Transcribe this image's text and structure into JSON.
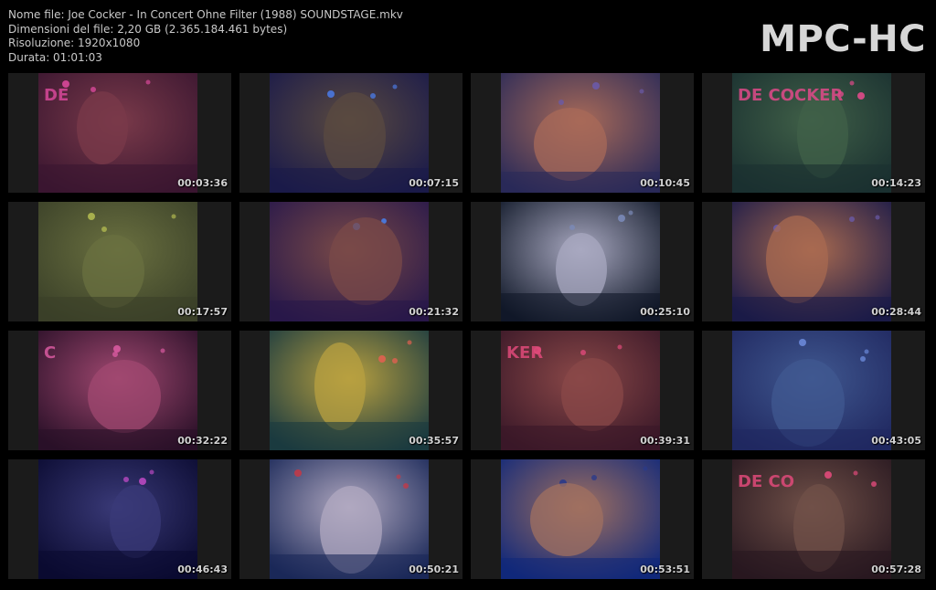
{
  "file_info": {
    "name": "Nome file: Joe Cocker - In Concert Ohne Filter (1988) SOUNDSTAGE.mkv",
    "size": "Dimensioni del file: 2,20 GB (2.365.184.461 bytes)",
    "resolution": "Risoluzione: 1920x1080",
    "duration": "Durata: 01:01:03"
  },
  "logo": "MPC-HC",
  "thumbnails": [
    {
      "time": "00:03:36",
      "bg": "#3a1630",
      "fg": "#7a3a4a",
      "accent": "#d8489a",
      "overlay_text": "DE"
    },
    {
      "time": "00:07:15",
      "bg": "#1a1a4a",
      "fg": "#5a4a40",
      "accent": "#4a78e0"
    },
    {
      "time": "00:10:45",
      "bg": "#2a2a58",
      "fg": "#a86a58",
      "accent": "#6a5aa8"
    },
    {
      "time": "00:14:23",
      "bg": "#1a3030",
      "fg": "#406048",
      "accent": "#e04a8a",
      "overlay_text": "DE COCKER"
    },
    {
      "time": "00:17:57",
      "bg": "#3a4028",
      "fg": "#6a7040",
      "accent": "#b0b850"
    },
    {
      "time": "00:21:32",
      "bg": "#28184a",
      "fg": "#7a4a48",
      "accent": "#4a7ae0"
    },
    {
      "time": "00:25:10",
      "bg": "#101828",
      "fg": "#a8a8c0",
      "accent": "#7a8ab8"
    },
    {
      "time": "00:28:44",
      "bg": "#1a1a48",
      "fg": "#a86a50",
      "accent": "#6a5aa8"
    },
    {
      "time": "00:32:22",
      "bg": "#2a1028",
      "fg": "#a04870",
      "accent": "#d85aa0",
      "overlay_text": "C"
    },
    {
      "time": "00:35:57",
      "bg": "#1a3a40",
      "fg": "#b8a040",
      "accent": "#e06050"
    },
    {
      "time": "00:39:31",
      "bg": "#3a1828",
      "fg": "#8a4848",
      "accent": "#e04a7a",
      "overlay_text": "KER"
    },
    {
      "time": "00:43:05",
      "bg": "#202860",
      "fg": "#405890",
      "accent": "#6a88d8"
    },
    {
      "time": "00:46:43",
      "bg": "#0a0a30",
      "fg": "#3a3a78",
      "accent": "#b848c0"
    },
    {
      "time": "00:50:21",
      "bg": "#1a2858",
      "fg": "#b0a8c0",
      "accent": "#c03a48"
    },
    {
      "time": "00:53:51",
      "bg": "#10287a",
      "fg": "#a07060",
      "accent": "#2a3a8a"
    },
    {
      "time": "00:57:28",
      "bg": "#281820",
      "fg": "#705048",
      "accent": "#e04a7a",
      "overlay_text": "DE CO"
    }
  ]
}
